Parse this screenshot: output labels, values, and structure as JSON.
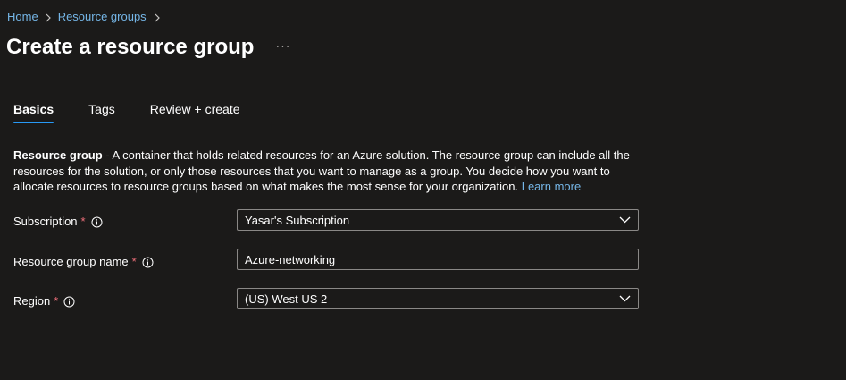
{
  "breadcrumb": {
    "items": [
      "Home",
      "Resource groups"
    ]
  },
  "header": {
    "title": "Create a resource group",
    "more_label": "···"
  },
  "tabs": [
    {
      "label": "Basics",
      "active": true
    },
    {
      "label": "Tags",
      "active": false
    },
    {
      "label": "Review + create",
      "active": false
    }
  ],
  "description": {
    "bold": "Resource group",
    "text": " - A container that holds related resources for an Azure solution. The resource group can include all the resources for the solution, or only those resources that you want to manage as a group. You decide how you want to allocate resources to resource groups based on what makes the most sense for your organization.",
    "link": "Learn more"
  },
  "form": {
    "subscription": {
      "label": "Subscription",
      "required_mark": "*",
      "value": "Yasar's Subscription"
    },
    "resource_group_name": {
      "label": "Resource group name",
      "required_mark": "*",
      "value": "Azure-networking"
    },
    "region": {
      "label": "Region",
      "required_mark": "*",
      "value": "(US) West US 2"
    }
  },
  "colors": {
    "background": "#1b1a19",
    "link": "#75b6e7",
    "tab_underline": "#2899f5",
    "required": "#f1707b",
    "border": "#8a8886"
  }
}
